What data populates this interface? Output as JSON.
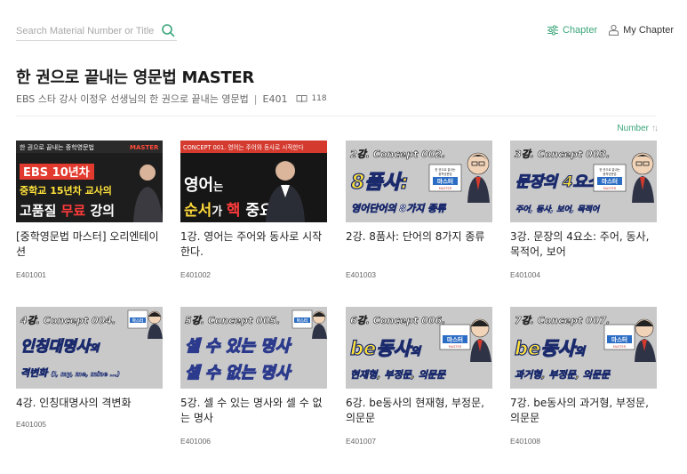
{
  "search": {
    "placeholder": "Search Material Number or Title"
  },
  "nav": {
    "chapter_label": "Chapter",
    "my_chapter_label": "My Chapter"
  },
  "book": {
    "title": "한 권으로 끝내는 영문법 MASTER",
    "subtitle": "EBS 스타 강사 이정우 선생님의 한 권으로 끝내는 영문법",
    "code": "E401",
    "count": "118"
  },
  "sort": {
    "label": "Number",
    "icon": "sort-arrows-icon"
  },
  "colors": {
    "accent": "#3aa57a"
  },
  "cards": [
    {
      "title": "[중학영문법 마스터] 오리엔테이션",
      "code": "E401001",
      "thumb": {
        "header": "한 권으로 끝내는 중학영문법",
        "header_tag": "MASTER",
        "line1": "EBS 10년차",
        "line2": "중학교 15년차 교사의",
        "line3a": "고품질 ",
        "line3b": "무료",
        "line3c": " 강의"
      }
    },
    {
      "title": "1강. 영어는 주어와 동사로 시작한다.",
      "code": "E401002",
      "thumb": {
        "header": "CONCEPT 001. 영어는 주어와 동사로 시작한다",
        "line1a": "영어",
        "line1b": "는",
        "line2a": "순서",
        "line2b": "가 ",
        "line2c": "핵",
        "line2d": " 중요!"
      }
    },
    {
      "title": "2강. 8품사: 단어의 8가지 종류",
      "code": "E401003",
      "thumb": {
        "concept": "2강. Concept 002.",
        "main": "8품사:",
        "sub": "영어단어의 8가지 종류"
      }
    },
    {
      "title": "3강. 문장의 4요소: 주어, 동사, 목적어, 보어",
      "code": "E401004",
      "thumb": {
        "concept": "3강. Concept 003.",
        "main": "문장의 4요소:",
        "sub": "주어, 동사, 보어, 목적어"
      }
    },
    {
      "title": "4강. 인칭대명사의 격변화",
      "code": "E401005",
      "thumb": {
        "concept": "4강. Concept 004.",
        "main": "인칭대명사",
        "main_suffix": "의",
        "sub": "격변화",
        "sub_extra": "(I, my, me, mine ...)"
      }
    },
    {
      "title": "5강. 셀 수 있는 명사와 셀 수 없는 명사",
      "code": "E401006",
      "thumb": {
        "concept": "5강. Concept 005.",
        "main": "셀 수 있는 명사",
        "sub": "셀 수 없는 명사"
      }
    },
    {
      "title": "6강. be동사의 현재형, 부정문, 의문문",
      "code": "E401007",
      "thumb": {
        "concept": "6강. Concept 006.",
        "main": "be동사",
        "main_suffix": "의",
        "sub": "현재형, 부정문, 의문문"
      }
    },
    {
      "title": "7강. be동사의 과거형, 부정문, 의문문",
      "code": "E401008",
      "thumb": {
        "concept": "7강. Concept 007.",
        "main": "be동사",
        "main_suffix": "의",
        "sub": "과거형, 부정문, 의문문"
      }
    }
  ],
  "badge": {
    "line1": "한 권으로 끝내는",
    "line2": "중학영문법",
    "line3": "마스터",
    "line4": "MASTER"
  }
}
